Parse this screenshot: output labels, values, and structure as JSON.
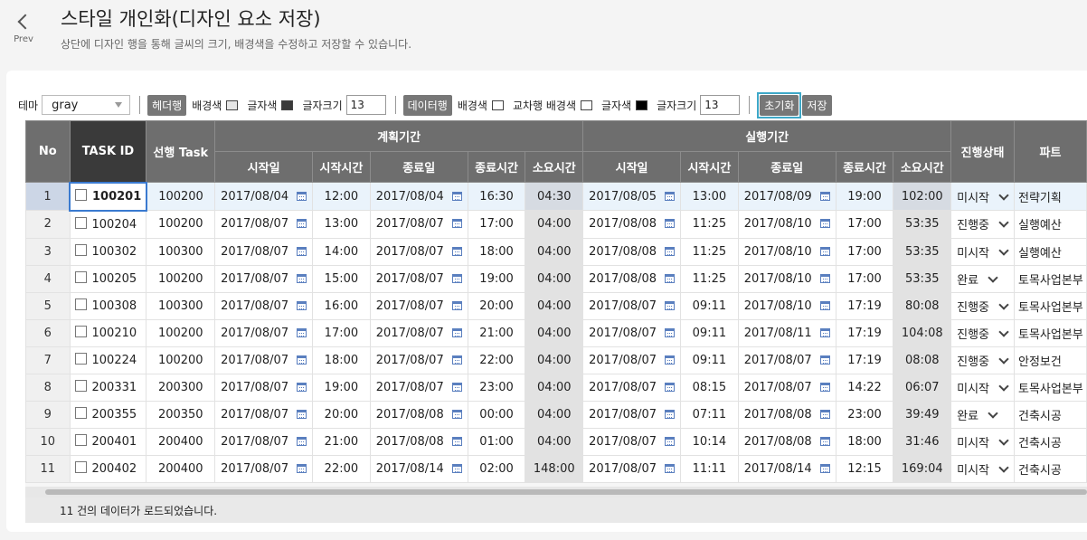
{
  "nav": {
    "prev_label": "Prev"
  },
  "page": {
    "title": "스타일 개인화(디자인 요소 저장)",
    "subtitle": "상단에 디자인 행을 통해 글씨의 크기, 배경색을 수정하고 저장할 수 있습니다."
  },
  "toolbar": {
    "theme_label": "테마",
    "theme_value": "gray",
    "header_row_button": "헤더행",
    "header_bg_label": "배경색",
    "header_bg_color": "#e6e6e6",
    "header_fg_label": "글자색",
    "header_fg_color": "#3a3a3a",
    "header_font_label": "글자크기",
    "header_font_value": "13",
    "data_row_button": "데이터행",
    "data_bg_label": "배경색",
    "data_bg_color": "#ffffff",
    "alt_bg_label": "교차행 배경색",
    "alt_bg_color": "#ffffff",
    "data_fg_label": "글자색",
    "data_fg_color": "#000000",
    "data_font_label": "글자크기",
    "data_font_value": "13",
    "reset_button": "초기화",
    "save_button": "저장"
  },
  "grid": {
    "headers": {
      "no": "No",
      "task_id": "TASK ID",
      "pred_task": "선행 Task",
      "plan_group": "계획기간",
      "actual_group": "실행기간",
      "status": "진행상태",
      "part": "파트",
      "start_date": "시작일",
      "start_time": "시작시간",
      "end_date": "종료일",
      "end_time": "종료시간",
      "duration": "소요시간"
    },
    "rows": [
      {
        "no": "1",
        "task_id": "100201",
        "pred": "100200",
        "p_start": "2017/08/04",
        "p_stime": "12:00",
        "p_end": "2017/08/04",
        "p_etime": "16:30",
        "p_dur": "04:30",
        "a_start": "2017/08/05",
        "a_stime": "13:00",
        "a_end": "2017/08/09",
        "a_etime": "19:00",
        "a_dur": "102:00",
        "status": "미시작",
        "part": "전략기획"
      },
      {
        "no": "2",
        "task_id": "100204",
        "pred": "100200",
        "p_start": "2017/08/07",
        "p_stime": "13:00",
        "p_end": "2017/08/07",
        "p_etime": "17:00",
        "p_dur": "04:00",
        "a_start": "2017/08/08",
        "a_stime": "11:25",
        "a_end": "2017/08/10",
        "a_etime": "17:00",
        "a_dur": "53:35",
        "status": "진행중",
        "part": "실행예산"
      },
      {
        "no": "3",
        "task_id": "100302",
        "pred": "100300",
        "p_start": "2017/08/07",
        "p_stime": "14:00",
        "p_end": "2017/08/07",
        "p_etime": "18:00",
        "p_dur": "04:00",
        "a_start": "2017/08/08",
        "a_stime": "11:25",
        "a_end": "2017/08/10",
        "a_etime": "17:00",
        "a_dur": "53:35",
        "status": "미시작",
        "part": "실행예산"
      },
      {
        "no": "4",
        "task_id": "100205",
        "pred": "100200",
        "p_start": "2017/08/07",
        "p_stime": "15:00",
        "p_end": "2017/08/07",
        "p_etime": "19:00",
        "p_dur": "04:00",
        "a_start": "2017/08/08",
        "a_stime": "11:25",
        "a_end": "2017/08/10",
        "a_etime": "17:00",
        "a_dur": "53:35",
        "status": "완료",
        "part": "토목사업본부"
      },
      {
        "no": "5",
        "task_id": "100308",
        "pred": "100300",
        "p_start": "2017/08/07",
        "p_stime": "16:00",
        "p_end": "2017/08/07",
        "p_etime": "20:00",
        "p_dur": "04:00",
        "a_start": "2017/08/07",
        "a_stime": "09:11",
        "a_end": "2017/08/10",
        "a_etime": "17:19",
        "a_dur": "80:08",
        "status": "진행중",
        "part": "토목사업본부"
      },
      {
        "no": "6",
        "task_id": "100210",
        "pred": "100200",
        "p_start": "2017/08/07",
        "p_stime": "17:00",
        "p_end": "2017/08/07",
        "p_etime": "21:00",
        "p_dur": "04:00",
        "a_start": "2017/08/07",
        "a_stime": "09:11",
        "a_end": "2017/08/11",
        "a_etime": "17:19",
        "a_dur": "104:08",
        "status": "진행중",
        "part": "토목사업본부"
      },
      {
        "no": "7",
        "task_id": "100224",
        "pred": "100200",
        "p_start": "2017/08/07",
        "p_stime": "18:00",
        "p_end": "2017/08/07",
        "p_etime": "22:00",
        "p_dur": "04:00",
        "a_start": "2017/08/07",
        "a_stime": "09:11",
        "a_end": "2017/08/07",
        "a_etime": "17:19",
        "a_dur": "08:08",
        "status": "진행중",
        "part": "안정보건"
      },
      {
        "no": "8",
        "task_id": "200331",
        "pred": "200300",
        "p_start": "2017/08/07",
        "p_stime": "19:00",
        "p_end": "2017/08/07",
        "p_etime": "23:00",
        "p_dur": "04:00",
        "a_start": "2017/08/07",
        "a_stime": "08:15",
        "a_end": "2017/08/07",
        "a_etime": "14:22",
        "a_dur": "06:07",
        "status": "미시작",
        "part": "토목사업본부"
      },
      {
        "no": "9",
        "task_id": "200355",
        "pred": "200350",
        "p_start": "2017/08/07",
        "p_stime": "20:00",
        "p_end": "2017/08/08",
        "p_etime": "00:00",
        "p_dur": "04:00",
        "a_start": "2017/08/07",
        "a_stime": "07:11",
        "a_end": "2017/08/08",
        "a_etime": "23:00",
        "a_dur": "39:49",
        "status": "완료",
        "part": "건축시공"
      },
      {
        "no": "10",
        "task_id": "200401",
        "pred": "200400",
        "p_start": "2017/08/07",
        "p_stime": "21:00",
        "p_end": "2017/08/08",
        "p_etime": "01:00",
        "p_dur": "04:00",
        "a_start": "2017/08/07",
        "a_stime": "10:14",
        "a_end": "2017/08/08",
        "a_etime": "18:00",
        "a_dur": "31:46",
        "status": "미시작",
        "part": "건축시공"
      },
      {
        "no": "11",
        "task_id": "200402",
        "pred": "200400",
        "p_start": "2017/08/07",
        "p_stime": "22:00",
        "p_end": "2017/08/14",
        "p_etime": "02:00",
        "p_dur": "148:00",
        "a_start": "2017/08/07",
        "a_stime": "11:11",
        "a_end": "2017/08/14",
        "a_etime": "12:15",
        "a_dur": "169:04",
        "status": "미시작",
        "part": "건축시공"
      }
    ],
    "icons": {
      "row_checkbox": "checkbox-icon",
      "date_picker": "calendar-icon",
      "status_dropdown": "chevron-down-icon"
    }
  },
  "footer": {
    "status_text": "11 건의 데이터가 로드되었습니다."
  }
}
